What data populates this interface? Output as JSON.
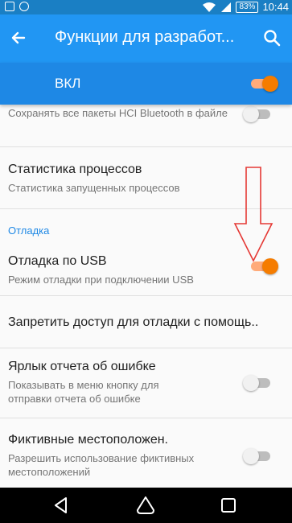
{
  "status_bar": {
    "battery": "83%",
    "time": "10:44"
  },
  "app_bar": {
    "title": "Функции для разработ..."
  },
  "master_switch": {
    "label": "ВКЛ",
    "on": true
  },
  "settings": {
    "hci": {
      "subtitle": "Сохранять все пакеты HCI Bluetooth в файле",
      "on": false
    },
    "process_stats": {
      "title": "Статистика процессов",
      "subtitle": "Статистика запущенных процессов"
    },
    "debug_section": "Отладка",
    "usb_debug": {
      "title": "Отладка по USB",
      "subtitle": "Режим отладки при подключении USB",
      "on": true
    },
    "revoke_access": {
      "title": "Запретить доступ для отладки с помощь.."
    },
    "bug_report": {
      "title": "Ярлык отчета об ошибке",
      "subtitle": "Показывать в меню кнопку для отправки отчета об ошибке",
      "on": false
    },
    "mock_location": {
      "title": "Фиктивные местоположен.",
      "subtitle": "Разрешить использование фиктивных местоположений",
      "on": false
    }
  },
  "colors": {
    "primary": "#2196f3",
    "status_bar": "#1a7fc4",
    "accent": "#f57c00",
    "arrow": "#e53935"
  }
}
